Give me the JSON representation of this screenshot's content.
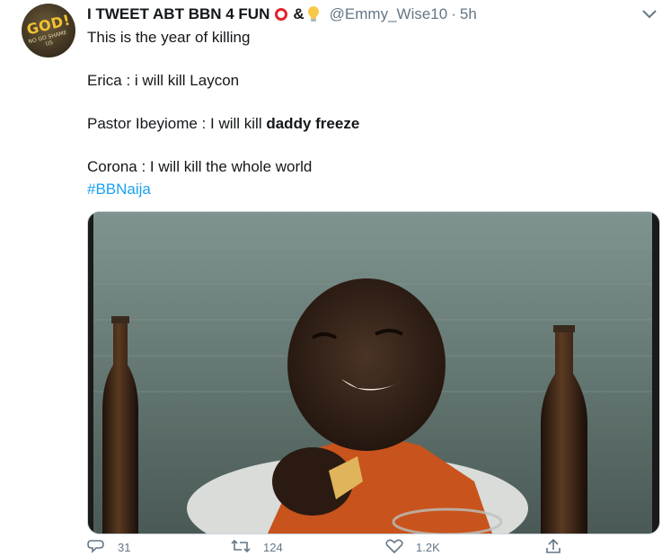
{
  "tweet": {
    "display_name": "I TWEET ABT BBN 4 FUN",
    "amp": "&",
    "handle": "@Emmy_Wise10",
    "separator": "·",
    "time": "5h",
    "avatar_text": "GOD!",
    "avatar_sub": "NO GO SHAME US",
    "lines": {
      "l1": "This is the year of killing",
      "l2": "Erica : i will kill Laycon",
      "l3_prefix": "Pastor Ibeyiome : I will kill ",
      "l3_bold": "daddy freeze",
      "l4": "Corona :  I will kill the whole world"
    },
    "hashtag": "#BBNaija",
    "actions": {
      "reply_count": "31",
      "retweet_count": "124",
      "like_count": "1.2K"
    },
    "colors": {
      "link": "#1da1f2",
      "secondary": "#657786",
      "circle": "#e0242a"
    }
  }
}
